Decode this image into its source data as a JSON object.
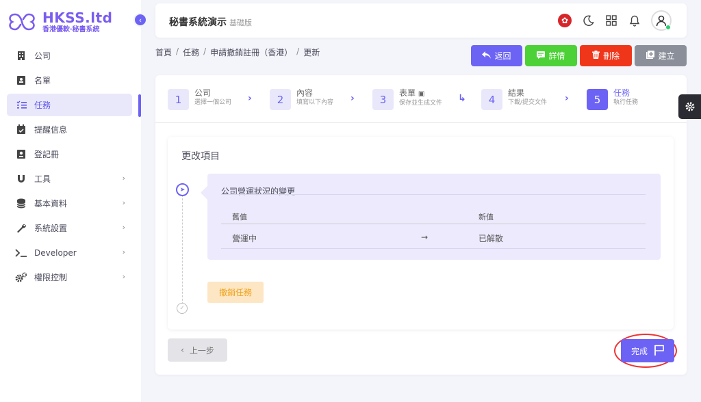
{
  "brand": {
    "name": "HKSS.ltd",
    "subtitle": "香港優軟‧秘書系統",
    "accent": "#6c63f5"
  },
  "sidebar": {
    "items": [
      {
        "label": "公司",
        "icon": "building-icon"
      },
      {
        "label": "名單",
        "icon": "contact-card-icon"
      },
      {
        "label": "任務",
        "icon": "task-list-icon",
        "active": true
      },
      {
        "label": "提醒信息",
        "icon": "calendar-check-icon"
      },
      {
        "label": "登記冊",
        "icon": "register-book-icon"
      },
      {
        "label": "工具",
        "icon": "magnet-icon",
        "expandable": true
      },
      {
        "label": "基本資料",
        "icon": "database-icon",
        "expandable": true
      },
      {
        "label": "系統設置",
        "icon": "wrench-icon",
        "expandable": true
      },
      {
        "label": "Developer",
        "icon": "terminal-icon",
        "expandable": true
      },
      {
        "label": "權限控制",
        "icon": "cogs-icon",
        "expandable": true
      }
    ]
  },
  "header": {
    "title": "秘書系統演示",
    "edition": "基礎版"
  },
  "breadcrumb": [
    "首頁",
    "任務",
    "申請撤銷註冊（香港）",
    "更新"
  ],
  "actions": {
    "back": "返回",
    "detail": "詳情",
    "delete": "刪除",
    "create": "建立"
  },
  "steps": [
    {
      "num": "1",
      "title": "公司",
      "sub": "選擇一個公司"
    },
    {
      "num": "2",
      "title": "內容",
      "sub": "填寫以下內容"
    },
    {
      "num": "3",
      "title": "表單",
      "sub": "保存並生成文件"
    },
    {
      "num": "4",
      "title": "結果",
      "sub": "下載/提交文件"
    },
    {
      "num": "5",
      "title": "任務",
      "sub": "執行任務",
      "active": true
    }
  ],
  "changes": {
    "section_title": "更改項目",
    "item_title": "公司營運狀況的變更",
    "col_old": "舊值",
    "col_new": "新值",
    "old_value": "營運中",
    "arrow": "→",
    "new_value": "已解散"
  },
  "cancel_task_label": "撤銷任務",
  "prev_button": "上一步",
  "done_button": "完成"
}
